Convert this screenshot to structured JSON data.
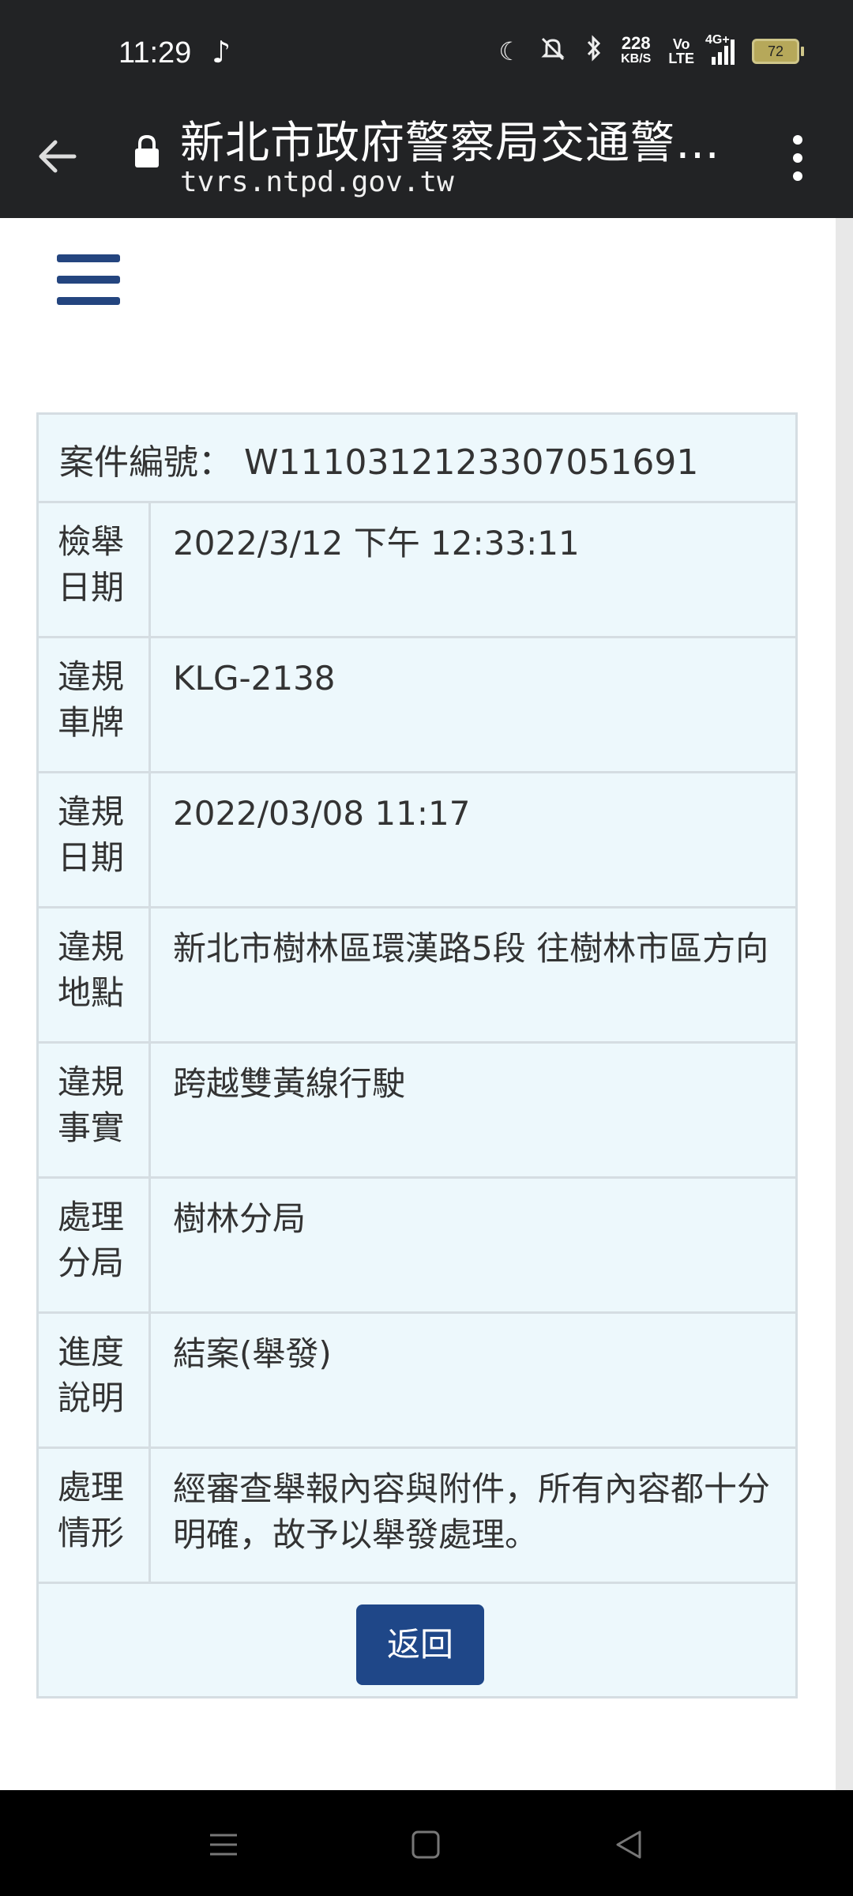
{
  "status_bar": {
    "time": "11:29",
    "net_speed_value": "228",
    "net_speed_unit": "KB/S",
    "volte_top": "Vo",
    "volte_bottom": "LTE",
    "network_type": "4G+",
    "battery_level": "72"
  },
  "browser": {
    "page_title": "新北市政府警察局交通警察...",
    "url": "tvrs.ntpd.gov.tw"
  },
  "record": {
    "case_number_label": "案件編號：",
    "case_number": "W1110312123307051691",
    "rows": [
      {
        "label_line1": "檢舉",
        "label_line2": "日期",
        "value": "2022/3/12 下午 12:33:11"
      },
      {
        "label_line1": "違規",
        "label_line2": "車牌",
        "value": "KLG-2138"
      },
      {
        "label_line1": "違規",
        "label_line2": "日期",
        "value": "2022/03/08 11:17"
      },
      {
        "label_line1": "違規",
        "label_line2": "地點",
        "value": "新北市樹林區環漢路5段 往樹林市區方向"
      },
      {
        "label_line1": "違規",
        "label_line2": "事實",
        "value": "跨越雙黃線行駛"
      },
      {
        "label_line1": "處理",
        "label_line2": "分局",
        "value": "樹林分局"
      },
      {
        "label_line1": "進度",
        "label_line2": "說明",
        "value": "結案(舉發)"
      },
      {
        "label_line1": "處理",
        "label_line2": "情形",
        "value": "經審查舉報內容與附件，所有內容都十分明確，故予以舉發處理。"
      }
    ],
    "back_button": "返回"
  },
  "colors": {
    "accent": "#24457f",
    "button": "#1f4788",
    "card_bg": "#edf8fc",
    "card_border": "#d5dde2",
    "browser_bar": "#222325"
  }
}
